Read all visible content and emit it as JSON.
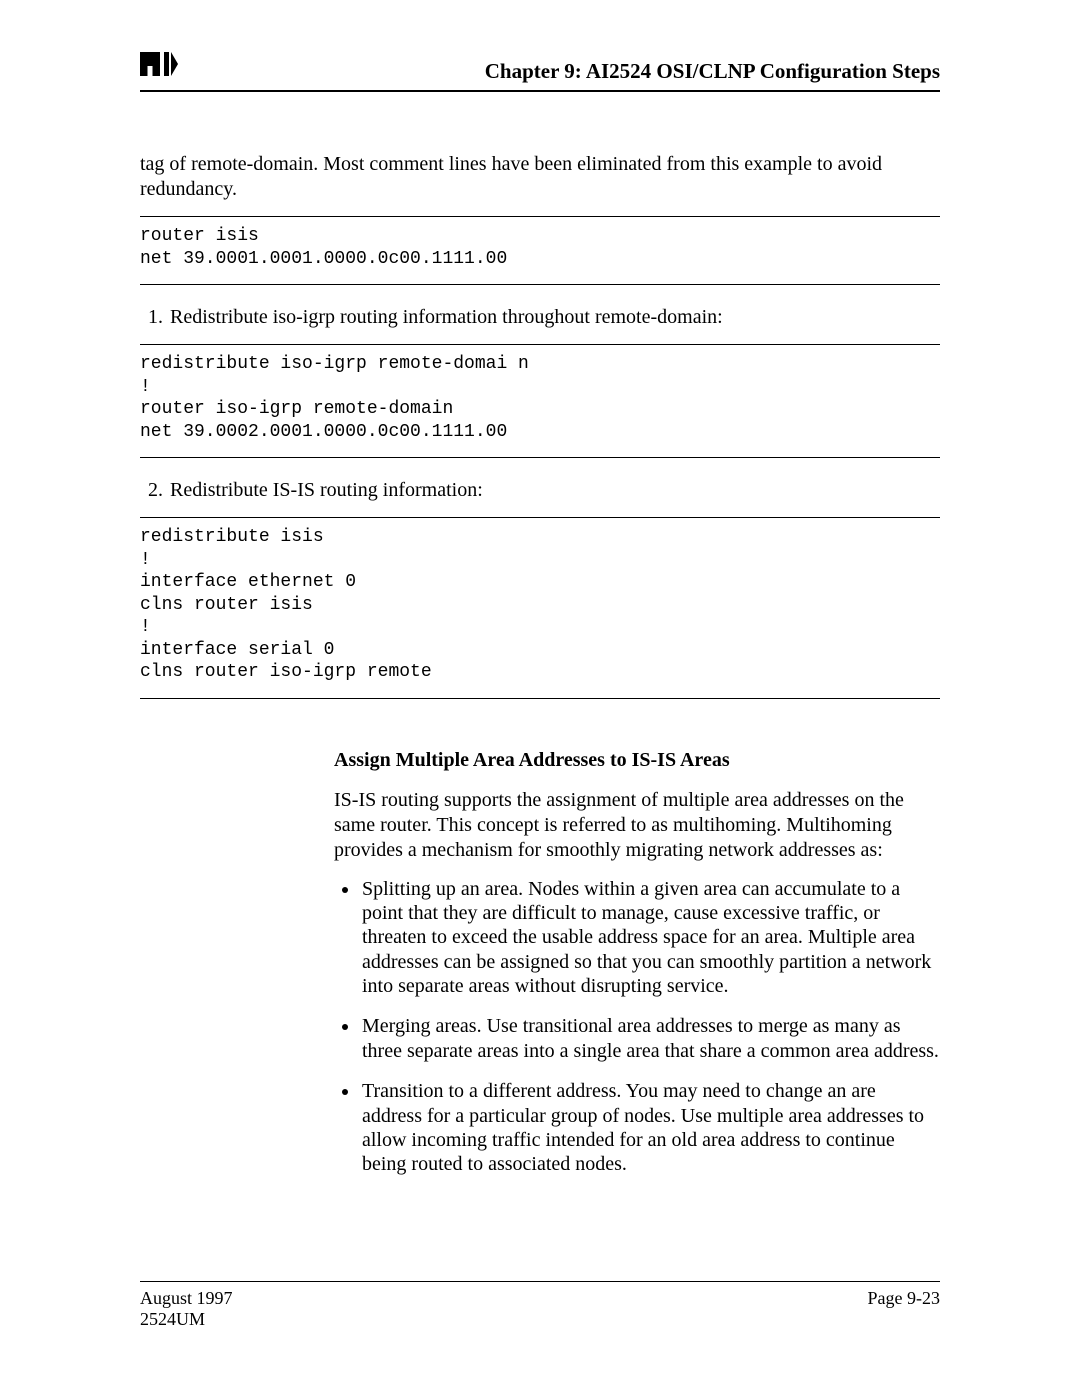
{
  "header": {
    "logo_text": "AI",
    "chapter_title": "Chapter 9: AI2524 OSI/CLNP Configuration Steps"
  },
  "intro_paragraph": "tag of remote-domain. Most comment lines have been eliminated from this example to avoid redundancy.",
  "code_block_1": "router isis\nnet 39.0001.0001.0000.0c00.1111.00",
  "list1_start": 1,
  "list1_item": "Redistribute iso-igrp routing information throughout remote-domain:",
  "code_block_2": "redistribute iso-igrp remote-domai n\n!\nrouter iso-igrp remote-domain\nnet 39.0002.0001.0000.0c00.1111.00",
  "list2_start": 2,
  "list2_item": "Redistribute IS-IS routing information:",
  "code_block_3": "redistribute isis\n!\ninterface ethernet 0\nclns router isis\n!\ninterface serial 0\nclns router iso-igrp remote",
  "section_heading": "Assign Multiple Area Addresses to IS-IS Areas",
  "section_paragraph": "IS-IS routing supports the assignment of multiple area addresses on the same router. This concept is referred to as multihoming. Multihoming provides a mechanism for smoothly migrating network addresses as:",
  "bullets": {
    "b1": "Splitting up an area. Nodes within a given area can accumulate to a point that they are difficult to manage, cause excessive traffic, or threaten to exceed the usable address space for an area. Multiple area addresses can be assigned so that you can smoothly partition a network into separate areas without disrupting service.",
    "b2": "Merging areas. Use transitional area addresses to merge as many as three separate areas into a single area that share a common area address.",
    "b3": "Transition to a different address. You may need to change an are address for a particular group of nodes. Use multiple area addresses to allow incoming traffic intended for an old area address to continue being routed to associated nodes."
  },
  "footer": {
    "date": "August 1997",
    "doc_id": "2524UM",
    "page_label": "Page 9-23"
  }
}
